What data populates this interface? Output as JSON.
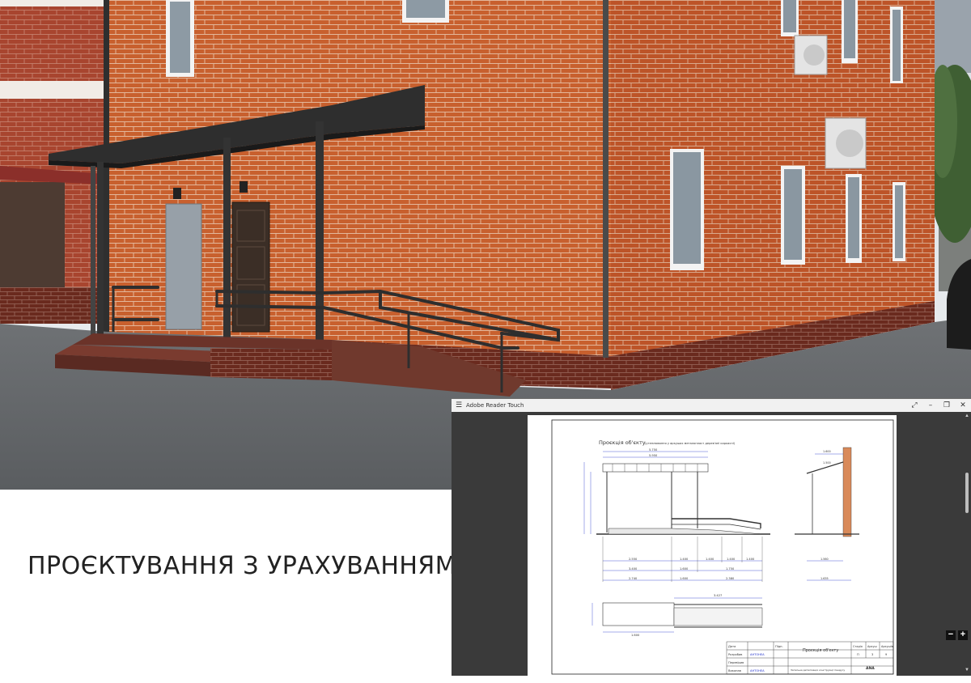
{
  "caption": "ПРОЄКТУВАННЯ З УРАХУВАННЯМ МГН",
  "reader": {
    "title": "Adobe Reader Touch",
    "menu_icon": "hamburger-icon",
    "controls": {
      "expand": "⤢",
      "minimize": "–",
      "restore": "❐",
      "close": "✕"
    },
    "zoom_out": "−",
    "zoom_in": "+",
    "drawing": {
      "heading": "Проєкція об'єкту",
      "subheading": "(утеплювання у аркушах металопласт дерев'яні каркасні)",
      "dims_top": [
        "5.750",
        "5.950"
      ],
      "dims_bottom_row1": [
        "2.550",
        "1.400",
        "1.400",
        "1.400",
        "1.400"
      ],
      "dims_bottom_row2": [
        "3.400",
        "1.600",
        "1.750"
      ],
      "dims_bottom_row3": [
        "2.740",
        "1.600",
        "2.380"
      ],
      "side_dims": [
        "1.600",
        "1.500",
        "1.560",
        "1.635"
      ],
      "plan_dims": [
        "3.427",
        "1.600"
      ],
      "title_block": {
        "row_labels": [
          "Дата",
          "Розробив",
          "Перевірив",
          "Виконав"
        ],
        "names": [
          "АНТОНЕА",
          "АНТОНЕА"
        ],
        "col_sign": "Підп.",
        "sheet_title": "Проєкція об'єкту",
        "subtitle": "Загальна деталізація конструкції пандусу",
        "stage_headers": [
          "Стадія",
          "Аркуш",
          "Аркушів"
        ],
        "stage_values": [
          "П",
          "3",
          "9"
        ],
        "logo_text": "ANA"
      }
    }
  }
}
